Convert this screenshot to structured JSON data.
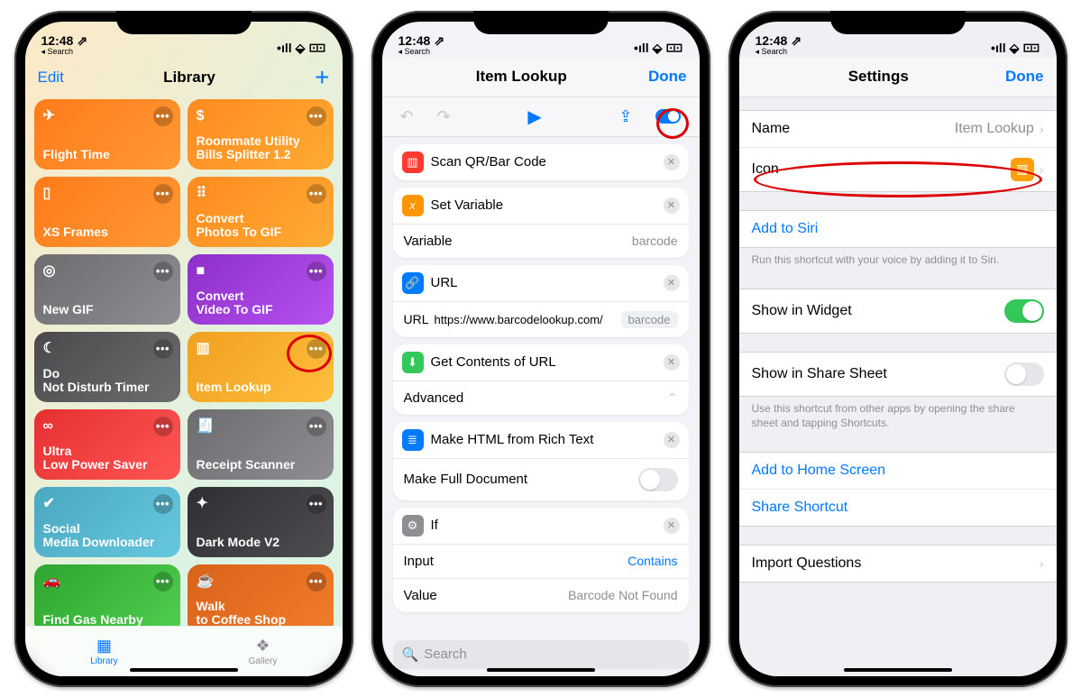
{
  "status": {
    "back": "◂ Search",
    "time": "12:48",
    "loc": "↿",
    "signal": "••ıl",
    "wifi": "⧋",
    "batt": "⃞"
  },
  "phone1": {
    "nav": {
      "edit": "Edit",
      "title": "Library",
      "add": "+"
    },
    "tiles": [
      {
        "label": "Flight Time",
        "cls": "orange1",
        "glyph": "✈"
      },
      {
        "label": "Roommate Utility\nBills Splitter 1.2",
        "cls": "orange2",
        "glyph": "$"
      },
      {
        "label": "XS Frames",
        "cls": "orange1",
        "glyph": "▯"
      },
      {
        "label": "Convert\nPhotos To GIF",
        "cls": "orange2",
        "glyph": "⠿"
      },
      {
        "label": "New GIF",
        "cls": "gray",
        "glyph": "◎"
      },
      {
        "label": "Convert\nVideo To GIF",
        "cls": "purple",
        "glyph": "■"
      },
      {
        "label": "Do\nNot Disturb Timer",
        "cls": "darkgray",
        "glyph": "☾"
      },
      {
        "label": "Item Lookup",
        "cls": "amber",
        "glyph": "▥"
      },
      {
        "label": "Ultra\nLow Power Saver",
        "cls": "red",
        "glyph": "∞"
      },
      {
        "label": "Receipt Scanner",
        "cls": "gray",
        "glyph": "🧾"
      },
      {
        "label": "Social\nMedia Downloader",
        "cls": "teal",
        "glyph": "✔"
      },
      {
        "label": "Dark Mode V2",
        "cls": "slate",
        "glyph": "✦"
      },
      {
        "label": "Find Gas Nearby",
        "cls": "green",
        "glyph": "🚗"
      },
      {
        "label": "Walk\nto Coffee Shop",
        "cls": "dorange",
        "glyph": "☕"
      }
    ],
    "tabs": {
      "library": "Library",
      "gallery": "Gallery"
    }
  },
  "phone2": {
    "nav": {
      "title": "Item Lookup",
      "done": "Done"
    },
    "toolbar": {
      "undo": "↶",
      "redo": "↷",
      "play": "▶",
      "share": "⇧",
      "toggle": true
    },
    "actions": {
      "a1": {
        "name": "Scan QR/Bar Code",
        "color": "ci-red",
        "glyph": "▥"
      },
      "a2": {
        "name": "Set Variable",
        "color": "ci-orange",
        "glyph": "x",
        "row_label": "Variable",
        "row_value": "barcode"
      },
      "a3": {
        "name": "URL",
        "color": "ci-blue",
        "glyph": "🔗",
        "url_label": "URL",
        "url_value": "https://www.barcodelookup.com/",
        "pill": "barcode"
      },
      "a4": {
        "name": "Get Contents of URL",
        "color": "ci-green",
        "glyph": "⬇",
        "adv": "Advanced"
      },
      "a5": {
        "name": "Make HTML from Rich Text",
        "color": "ci-blue",
        "glyph": "≣",
        "row_label": "Make Full Document"
      },
      "a6": {
        "name": "If",
        "color": "ci-gray",
        "glyph": "⚙",
        "r1l": "Input",
        "r1v": "Contains",
        "r2l": "Value",
        "r2v": "Barcode Not Found"
      }
    },
    "search": "Search"
  },
  "phone3": {
    "nav": {
      "title": "Settings",
      "done": "Done"
    },
    "rows": {
      "name_l": "Name",
      "name_v": "Item Lookup",
      "icon_l": "Icon",
      "siri": "Add to Siri",
      "siri_hint": "Run this shortcut with your voice by adding it to Siri.",
      "widget": "Show in Widget",
      "share_sheet": "Show in Share Sheet",
      "share_hint": "Use this shortcut from other apps by opening the share sheet and tapping Shortcuts.",
      "home": "Add to Home Screen",
      "share": "Share Shortcut",
      "import": "Import Questions"
    }
  }
}
